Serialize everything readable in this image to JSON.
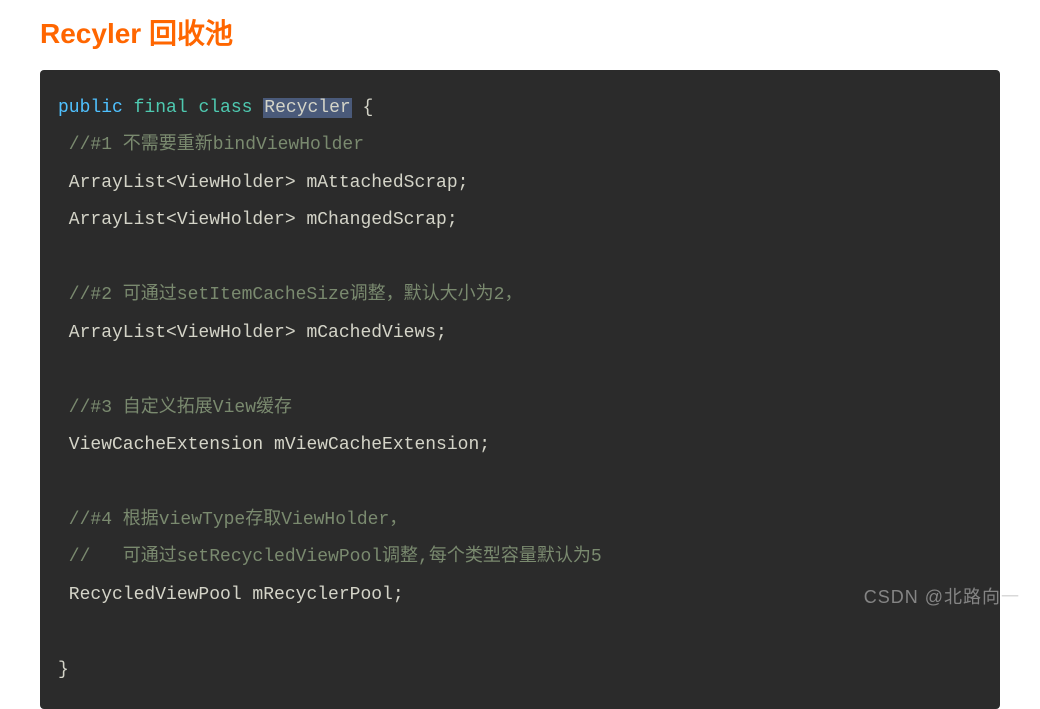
{
  "title": "Recyler 回收池",
  "code": {
    "line1": {
      "kw_public": "public",
      "kw_final": "final",
      "kw_class": "class",
      "class_name": "Recycler",
      "brace_open": " {"
    },
    "c1": " //#1 不需要重新bindViewHolder",
    "l2": " ArrayList<ViewHolder> mAttachedScrap;",
    "l3": " ArrayList<ViewHolder> mChangedScrap;",
    "blank1": "",
    "c2": " //#2 可通过setItemCacheSize调整，默认大小为2，",
    "l4": " ArrayList<ViewHolder> mCachedViews;",
    "blank2": "",
    "c3": " //#3 自定义拓展View缓存",
    "l5": " ViewCacheExtension mViewCacheExtension;",
    "blank3": "",
    "c4": " //#4 根据viewType存取ViewHolder，",
    "c5": " //   可通过setRecycledViewPool调整,每个类型容量默认为5",
    "l6": " RecycledViewPool mRecyclerPool;",
    "blank4": "",
    "brace_close": "}"
  },
  "watermark": "CSDN @北路向一"
}
